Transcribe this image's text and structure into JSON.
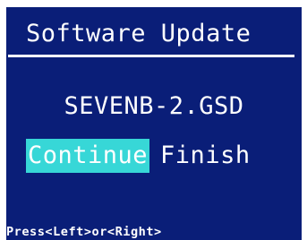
{
  "title": "Software Update",
  "filename": "SEVENB-2.GSD",
  "options": {
    "continue_label": "Continue",
    "finish_label": "Finish",
    "selected": "Continue"
  },
  "hint": "Press<Left>or<Right>",
  "colors": {
    "screen_background": "#0a1e78",
    "text": "#ffffff",
    "selection_highlight": "#37d7d7"
  }
}
